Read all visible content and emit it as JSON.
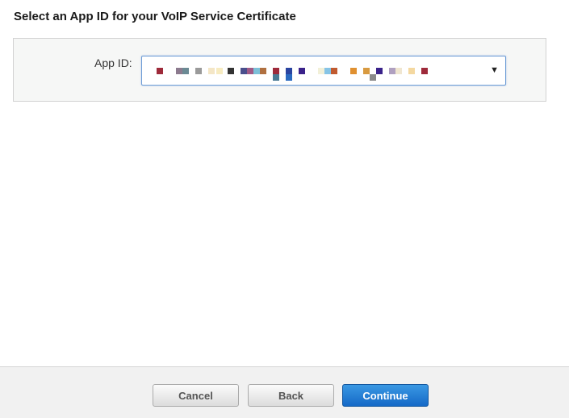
{
  "page": {
    "title": "Select an App ID for your VoIP Service Certificate"
  },
  "form": {
    "app_id_label": "App ID:",
    "app_id_select": {
      "selected_value_redacted": true,
      "arrow_icon": "triangle-down-icon"
    }
  },
  "footer": {
    "cancel_label": "Cancel",
    "back_label": "Back",
    "continue_label": "Continue"
  },
  "colors": {
    "primary_button": "#1f7fd8",
    "select_border": "#6d9cd6",
    "panel_background": "#f6f7f6",
    "footer_background": "#f1f1f1"
  }
}
